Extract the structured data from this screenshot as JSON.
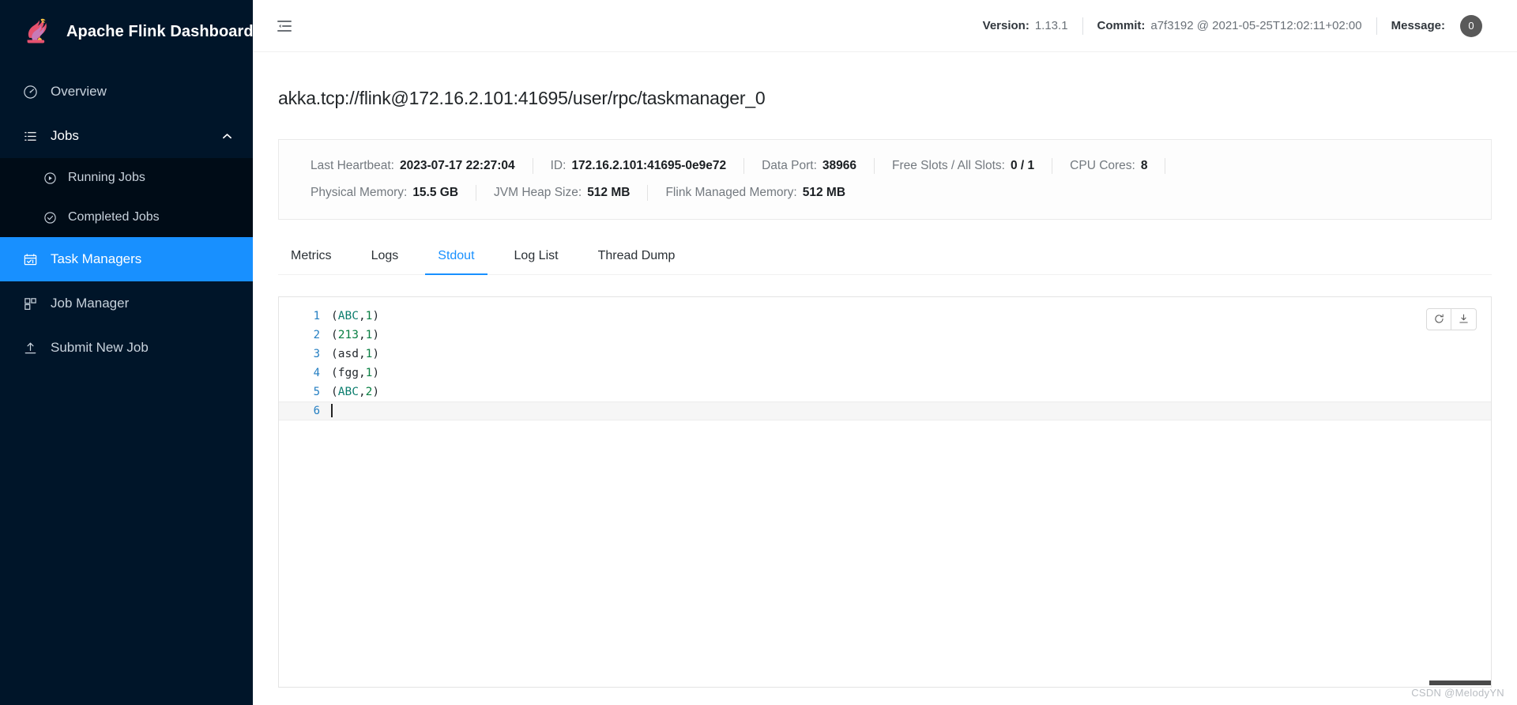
{
  "brand": {
    "title": "Apache Flink Dashboard",
    "logo_icon": "flink-squirrel-logo"
  },
  "sidebar": {
    "items": [
      {
        "id": "overview",
        "label": "Overview",
        "icon": "dashboard-icon",
        "state": "normal"
      },
      {
        "id": "jobs",
        "label": "Jobs",
        "icon": "list-icon",
        "state": "expanded",
        "chevron": "chevron-up-icon"
      },
      {
        "id": "task-managers",
        "label": "Task Managers",
        "icon": "taskmanager-icon",
        "state": "active"
      },
      {
        "id": "job-manager",
        "label": "Job Manager",
        "icon": "cluster-icon",
        "state": "normal"
      },
      {
        "id": "submit-new-job",
        "label": "Submit New Job",
        "icon": "upload-icon",
        "state": "normal"
      }
    ],
    "jobs_submenu": [
      {
        "id": "running-jobs",
        "label": "Running Jobs",
        "icon": "play-circle-icon"
      },
      {
        "id": "completed-jobs",
        "label": "Completed Jobs",
        "icon": "check-circle-icon"
      }
    ]
  },
  "topbar": {
    "fold_icon": "menu-fold-icon",
    "version_label": "Version:",
    "version_value": "1.13.1",
    "commit_label": "Commit:",
    "commit_value": "a7f3192 @ 2021-05-25T12:02:11+02:00",
    "message_label": "Message:",
    "message_count": "0"
  },
  "page": {
    "title": "akka.tcp://flink@172.16.2.101:41695/user/rpc/taskmanager_0"
  },
  "info": {
    "row1": [
      {
        "key": "Last Heartbeat:",
        "value": "2023-07-17 22:27:04"
      },
      {
        "key": "ID:",
        "value": "172.16.2.101:41695-0e9e72"
      },
      {
        "key": "Data Port:",
        "value": "38966"
      },
      {
        "key": "Free Slots / All Slots:",
        "value": "0 / 1"
      },
      {
        "key": "CPU Cores:",
        "value": "8"
      }
    ],
    "row2": [
      {
        "key": "Physical Memory:",
        "value": "15.5 GB"
      },
      {
        "key": "JVM Heap Size:",
        "value": "512 MB"
      },
      {
        "key": "Flink Managed Memory:",
        "value": "512 MB"
      }
    ]
  },
  "tabs": [
    {
      "id": "metrics",
      "label": "Metrics",
      "active": false
    },
    {
      "id": "logs",
      "label": "Logs",
      "active": false
    },
    {
      "id": "stdout",
      "label": "Stdout",
      "active": true
    },
    {
      "id": "log-list",
      "label": "Log List",
      "active": false
    },
    {
      "id": "thread-dump",
      "label": "Thread Dump",
      "active": false
    }
  ],
  "editor": {
    "refresh_icon": "refresh-icon",
    "download_icon": "download-icon",
    "lines": [
      {
        "n": "1",
        "open": "(",
        "word": "ABC",
        "word_type": "str",
        "comma": ",",
        "num": "1",
        "close": ")"
      },
      {
        "n": "2",
        "open": "(",
        "word": "213",
        "word_type": "num",
        "comma": ",",
        "num": "1",
        "close": ")"
      },
      {
        "n": "3",
        "open": "(",
        "word": "asd",
        "word_type": "pun",
        "comma": ",",
        "num": "1",
        "close": ")"
      },
      {
        "n": "4",
        "open": "(",
        "word": "fgg",
        "word_type": "pun",
        "comma": ",",
        "num": "1",
        "close": ")"
      },
      {
        "n": "5",
        "open": "(",
        "word": "ABC",
        "word_type": "str",
        "comma": ",",
        "num": "2",
        "close": ")"
      },
      {
        "n": "6",
        "open": "",
        "word": "",
        "word_type": "pun",
        "comma": "",
        "num": "",
        "close": ""
      }
    ]
  },
  "watermark": "CSDN @MelodyYN",
  "colors": {
    "sidebar_bg": "#001529",
    "submenu_bg": "#000c17",
    "accent": "#1890ff",
    "string_token": "#0b7d6e",
    "number_token": "#0a8043",
    "gutter": "#237ec2",
    "badge_bg": "#595959"
  }
}
